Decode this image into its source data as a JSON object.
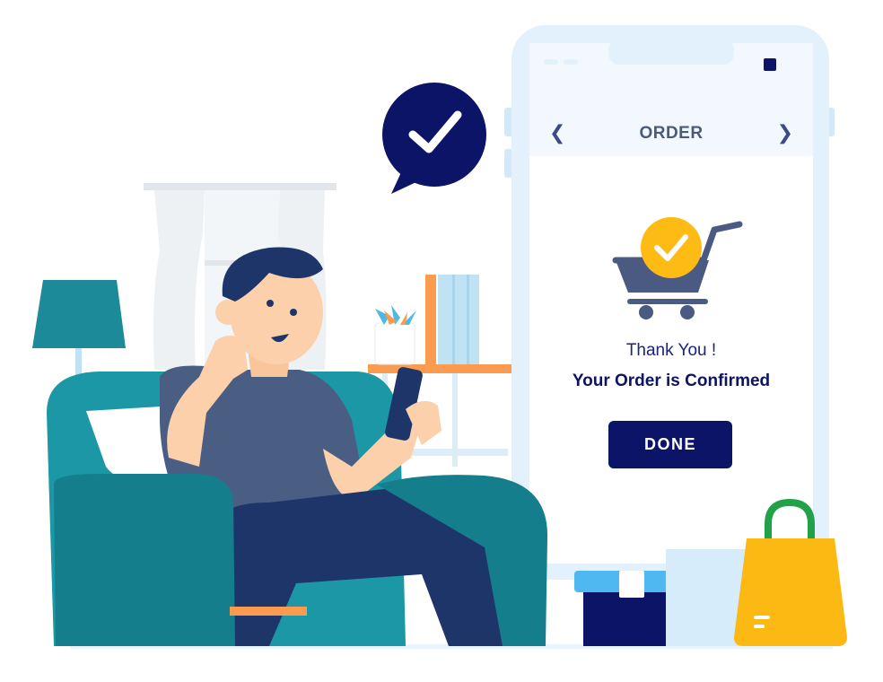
{
  "order_screen": {
    "title": "ORDER",
    "back_arrow": "❮",
    "forward_arrow": "❯",
    "thank_you": "Thank You !",
    "confirmation": "Your Order is Confirmed",
    "done_label": "DONE"
  },
  "icons": {
    "chat_bubble": "check-icon",
    "cart": "shopping-cart-icon",
    "cart_badge": "check-icon"
  },
  "colors": {
    "navy": "#0c1467",
    "phone_frame": "#e3f1fc",
    "teal_sofa": "#1b8a96",
    "check_badge": "#fdbb14",
    "shopping_bag": "#fdb913",
    "bag_handle": "#21a148"
  }
}
